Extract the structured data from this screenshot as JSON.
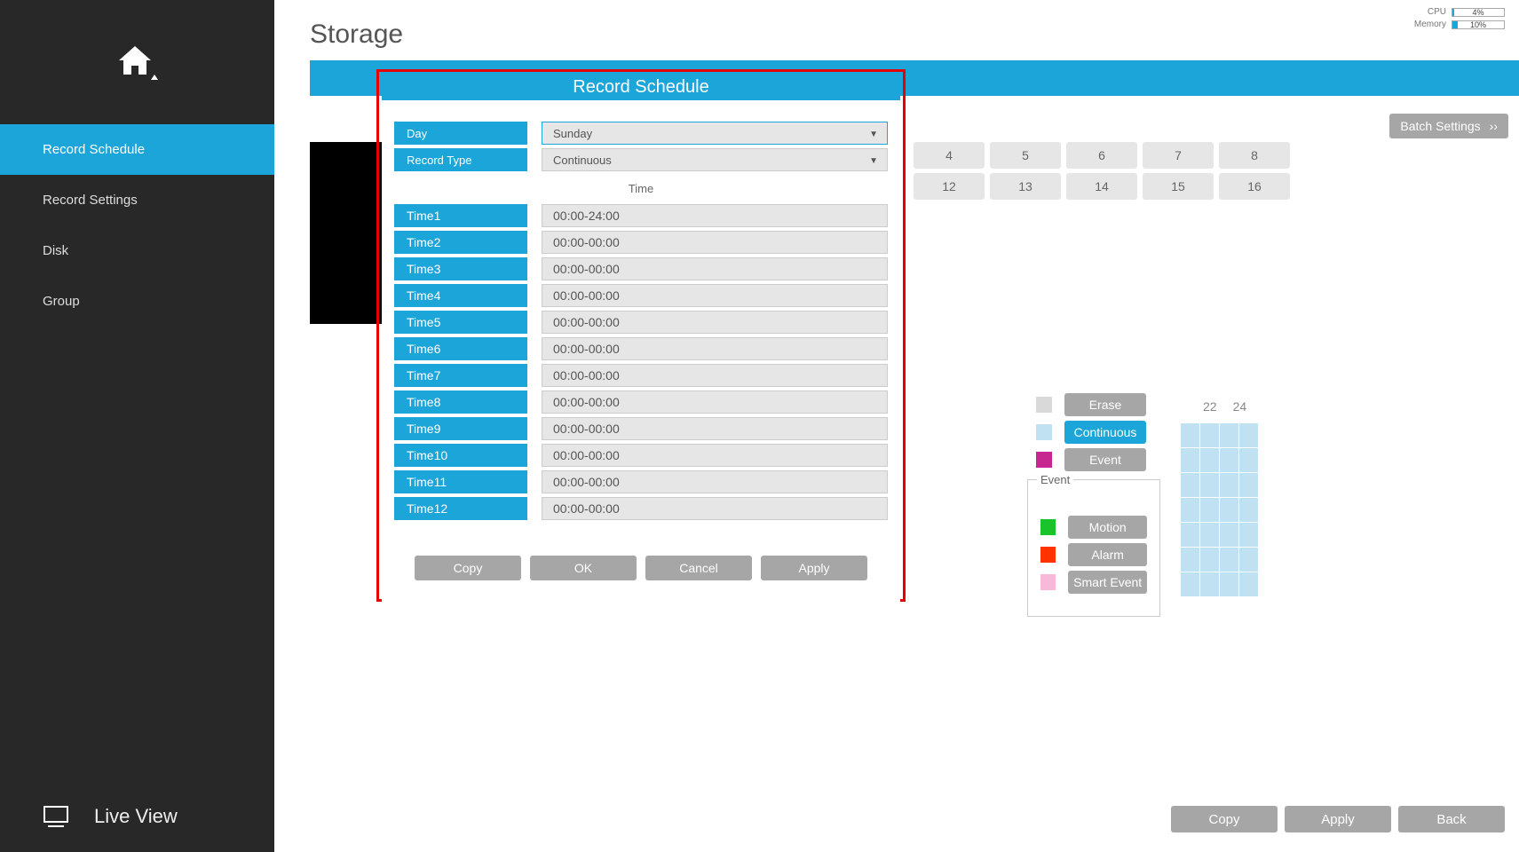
{
  "page": {
    "title": "Storage"
  },
  "system": {
    "cpu_label": "CPU",
    "cpu_pct": 4,
    "cpu_text": "4%",
    "mem_label": "Memory",
    "mem_pct": 10,
    "mem_text": "10%"
  },
  "sidebar": {
    "items": [
      {
        "label": "Record Schedule",
        "selected": true
      },
      {
        "label": "Record Settings",
        "selected": false
      },
      {
        "label": "Disk",
        "selected": false
      },
      {
        "label": "Group",
        "selected": false
      }
    ],
    "liveview_label": "Live View"
  },
  "batch_settings_label": "Batch Settings",
  "channels_row1": [
    "4",
    "5",
    "6",
    "7",
    "8"
  ],
  "channels_row2": [
    "12",
    "13",
    "14",
    "15",
    "16"
  ],
  "hour_labels": [
    "22",
    "24"
  ],
  "legend": {
    "erase": "Erase",
    "continuous": "Continuous",
    "event": "Event",
    "event_group_label": "Event",
    "motion": "Motion",
    "alarm": "Alarm",
    "smart": "Smart Event",
    "colors": {
      "erase": "#d9d9d9",
      "continuous": "#bfe1f2",
      "event": "#c7258f",
      "motion": "#19c32a",
      "alarm": "#ff3300",
      "smart": "#f7b8da"
    }
  },
  "bottom": {
    "copy": "Copy",
    "apply": "Apply",
    "back": "Back"
  },
  "modal": {
    "title": "Record Schedule",
    "day_label": "Day",
    "day_value": "Sunday",
    "type_label": "Record Type",
    "type_value": "Continuous",
    "time_header": "Time",
    "times": [
      {
        "label": "Time1",
        "value": "00:00-24:00"
      },
      {
        "label": "Time2",
        "value": "00:00-00:00"
      },
      {
        "label": "Time3",
        "value": "00:00-00:00"
      },
      {
        "label": "Time4",
        "value": "00:00-00:00"
      },
      {
        "label": "Time5",
        "value": "00:00-00:00"
      },
      {
        "label": "Time6",
        "value": "00:00-00:00"
      },
      {
        "label": "Time7",
        "value": "00:00-00:00"
      },
      {
        "label": "Time8",
        "value": "00:00-00:00"
      },
      {
        "label": "Time9",
        "value": "00:00-00:00"
      },
      {
        "label": "Time10",
        "value": "00:00-00:00"
      },
      {
        "label": "Time11",
        "value": "00:00-00:00"
      },
      {
        "label": "Time12",
        "value": "00:00-00:00"
      }
    ],
    "buttons": {
      "copy": "Copy",
      "ok": "OK",
      "cancel": "Cancel",
      "apply": "Apply"
    }
  }
}
